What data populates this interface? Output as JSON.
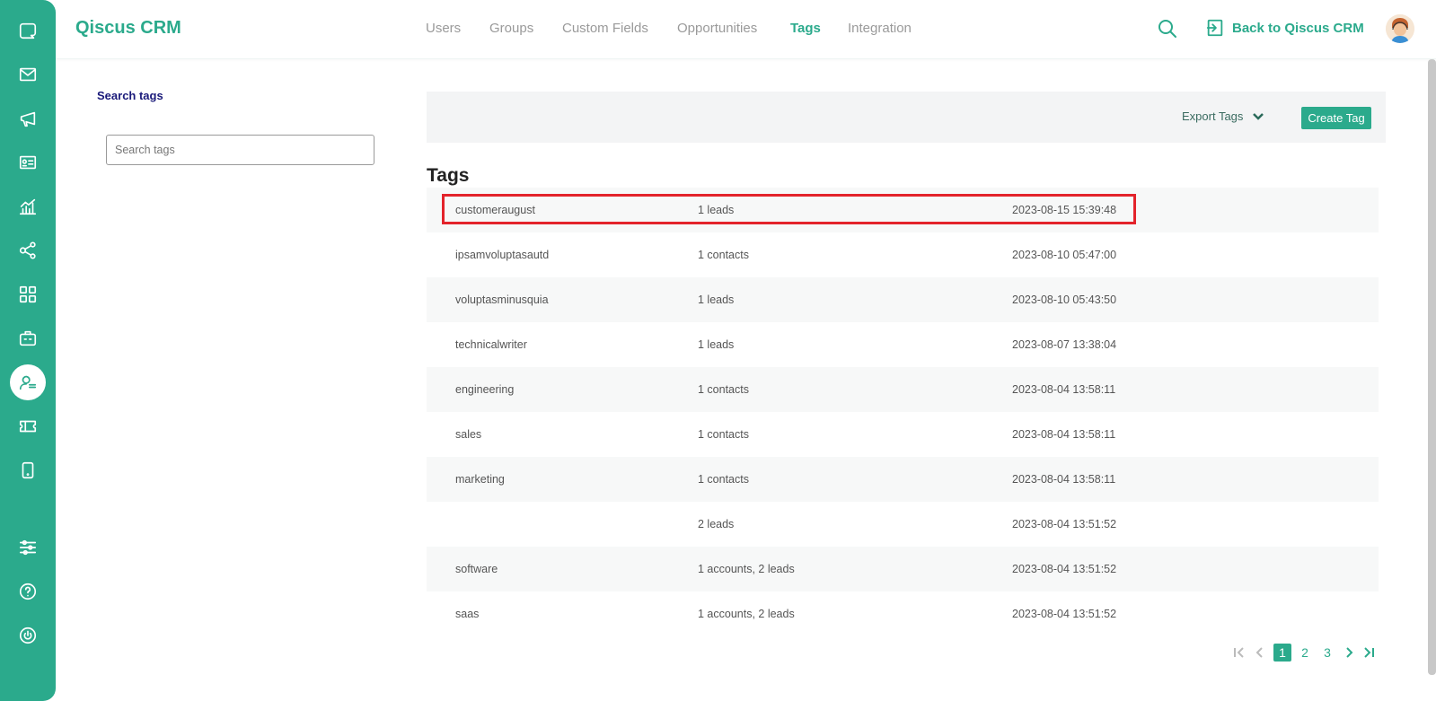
{
  "header": {
    "brand": "Qiscus CRM",
    "nav": [
      {
        "label": "Users"
      },
      {
        "label": "Groups"
      },
      {
        "label": "Custom Fields"
      },
      {
        "label": "Opportunities"
      },
      {
        "label": "Tags",
        "active": true
      },
      {
        "label": "Integration"
      }
    ],
    "back_label": "Back to Qiscus CRM"
  },
  "sidebar": {
    "icons": [
      "chat-icon",
      "mail-icon",
      "megaphone-icon",
      "contact-card-icon",
      "analytics-icon",
      "share-nodes-icon",
      "apps-grid-icon",
      "bot-icon",
      "agent-icon",
      "ticket-icon",
      "mobile-icon",
      "settings-sliders-icon",
      "help-icon",
      "power-icon"
    ],
    "active": "agent-icon"
  },
  "search": {
    "label": "Search tags",
    "placeholder": "Search tags",
    "value": ""
  },
  "toolbar": {
    "export_label": "Export Tags",
    "create_label": "Create Tag"
  },
  "table": {
    "title": "Tags",
    "rows": [
      {
        "name": "customeraugust",
        "count": "1 leads",
        "date": "2023-08-15 15:39:48",
        "highlighted": true
      },
      {
        "name": "ipsamvoluptasautd",
        "count": "1 contacts",
        "date": "2023-08-10 05:47:00"
      },
      {
        "name": "voluptasminusquia",
        "count": "1 leads",
        "date": "2023-08-10 05:43:50"
      },
      {
        "name": "technicalwriter",
        "count": "1 leads",
        "date": "2023-08-07 13:38:04"
      },
      {
        "name": "engineering",
        "count": "1 contacts",
        "date": "2023-08-04 13:58:11"
      },
      {
        "name": "sales",
        "count": "1 contacts",
        "date": "2023-08-04 13:58:11"
      },
      {
        "name": "marketing",
        "count": "1 contacts",
        "date": "2023-08-04 13:58:11"
      },
      {
        "name": "",
        "count": "2 leads",
        "date": "2023-08-04 13:51:52"
      },
      {
        "name": "software",
        "count": "1 accounts, 2 leads",
        "date": "2023-08-04 13:51:52"
      },
      {
        "name": "saas",
        "count": "1 accounts, 2 leads",
        "date": "2023-08-04 13:51:52"
      }
    ]
  },
  "pagination": {
    "pages": [
      "1",
      "2",
      "3"
    ],
    "current": "1"
  },
  "colors": {
    "accent": "#2baa8c",
    "highlight": "#e3232b"
  }
}
